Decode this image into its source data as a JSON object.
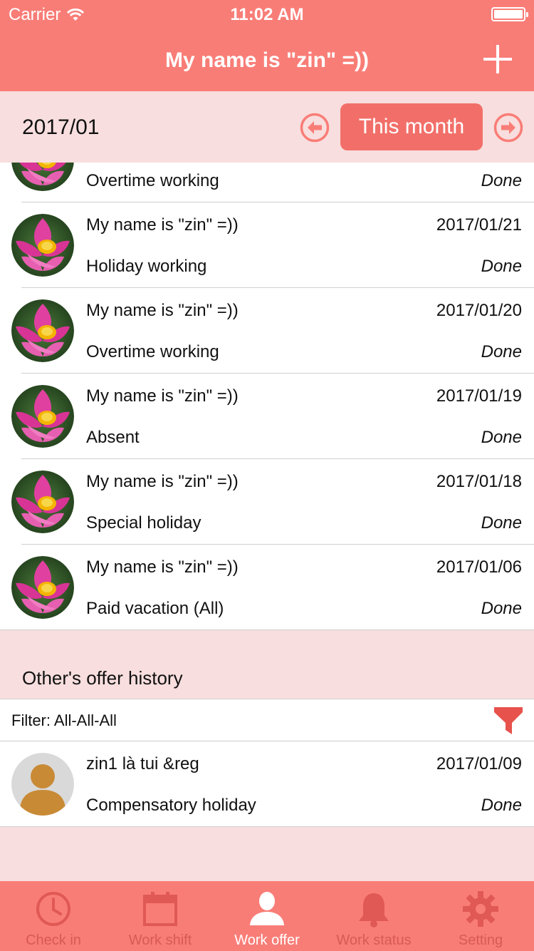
{
  "status_bar": {
    "carrier": "Carrier",
    "time": "11:02 AM"
  },
  "nav": {
    "title": "My name is \"zin\" =))"
  },
  "month_bar": {
    "month": "2017/01",
    "this_month_label": "This month"
  },
  "my_offers": [
    {
      "name": "",
      "date": "",
      "type": "Overtime working",
      "status": "Done",
      "avatar": "lotus"
    },
    {
      "name": "My name is \"zin\" =))",
      "date": "2017/01/21",
      "type": "Holiday working",
      "status": "Done",
      "avatar": "lotus"
    },
    {
      "name": "My name is \"zin\" =))",
      "date": "2017/01/20",
      "type": "Overtime working",
      "status": "Done",
      "avatar": "lotus"
    },
    {
      "name": "My name is \"zin\" =))",
      "date": "2017/01/19",
      "type": "Absent",
      "status": "Done",
      "avatar": "lotus"
    },
    {
      "name": "My name is \"zin\" =))",
      "date": "2017/01/18",
      "type": "Special holiday",
      "status": "Done",
      "avatar": "lotus"
    },
    {
      "name": "My name is \"zin\" =))",
      "date": "2017/01/06",
      "type": "Paid vacation (All)",
      "status": "Done",
      "avatar": "lotus"
    }
  ],
  "others_section": {
    "title": "Other's offer history",
    "filter_label": "Filter: All-All-All"
  },
  "others_offers": [
    {
      "name": "zin1 là tui &reg",
      "date": "2017/01/09",
      "type": "Compensatory holiday",
      "status": "Done",
      "avatar": "default-user"
    }
  ],
  "tabs": [
    {
      "label": "Check in",
      "icon": "clock-icon",
      "active": false
    },
    {
      "label": "Work shift",
      "icon": "calendar-icon",
      "active": false
    },
    {
      "label": "Work offer",
      "icon": "person-icon",
      "active": true
    },
    {
      "label": "Work status",
      "icon": "bell-icon",
      "active": false
    },
    {
      "label": "Setting",
      "icon": "gear-icon",
      "active": false
    }
  ],
  "colors": {
    "primary": "#f97d77",
    "section_bg": "#f8dede",
    "button": "#f26f69"
  }
}
